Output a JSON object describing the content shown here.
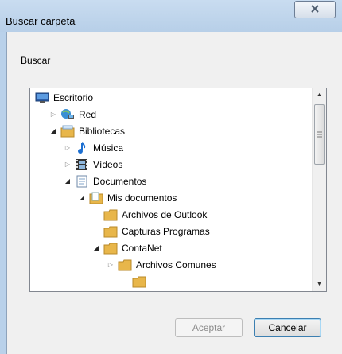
{
  "window": {
    "title": "Buscar carpeta",
    "close_icon": "close-x-icon"
  },
  "dialog": {
    "prompt": "Buscar"
  },
  "tree": {
    "items": [
      {
        "label": "Escritorio",
        "icon": "desktop-icon",
        "expander": "none"
      },
      {
        "label": "Red",
        "icon": "network-icon",
        "expander": "collapsed"
      },
      {
        "label": "Bibliotecas",
        "icon": "libraries-icon",
        "expander": "expanded"
      },
      {
        "label": "Música",
        "icon": "music-icon",
        "expander": "collapsed"
      },
      {
        "label": "Vídeos",
        "icon": "videos-icon",
        "expander": "collapsed"
      },
      {
        "label": "Documentos",
        "icon": "documents-icon",
        "expander": "expanded"
      },
      {
        "label": "Mis documentos",
        "icon": "my-documents-icon",
        "expander": "expanded"
      },
      {
        "label": "Archivos de Outlook",
        "icon": "folder-icon",
        "expander": "none"
      },
      {
        "label": "Capturas Programas",
        "icon": "folder-icon",
        "expander": "none"
      },
      {
        "label": "ContaNet",
        "icon": "folder-icon",
        "expander": "expanded"
      },
      {
        "label": "Archivos Comunes",
        "icon": "folder-icon",
        "expander": "collapsed"
      }
    ]
  },
  "buttons": {
    "ok": "Aceptar",
    "cancel": "Cancelar"
  },
  "colors": {
    "folder": "#e8b64a",
    "selection_border": "#3c7fb1",
    "window_frame": "#b9d1ea"
  }
}
